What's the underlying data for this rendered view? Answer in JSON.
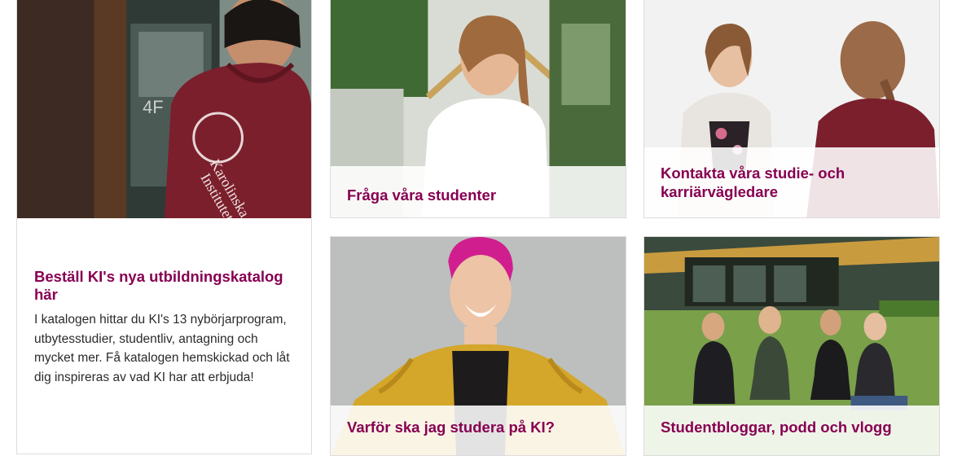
{
  "cards": {
    "catalog": {
      "title": "Beställ KI's nya utbildningskatalog här",
      "text": "I katalogen hittar du KI's 13 nybörjarprogram, utbytesstudier, studentliv, antagning och mycket mer.  Få katalogen hemskickad och låt dig inspireras av vad KI har att erbjuda!",
      "hoodie_text": "Karolinska Institutet"
    },
    "fraga": {
      "title": "Fråga våra studenter"
    },
    "kontakta": {
      "title": "Kontakta våra studie- och karriärvägledare"
    },
    "varfor": {
      "title": "Varför ska jag studera på KI?"
    },
    "blogg": {
      "title": "Studentbloggar, podd och vlogg"
    }
  },
  "colors": {
    "accent": "#870052",
    "hoodie": "#7b1f2c",
    "jacket": "#d4a62a"
  }
}
